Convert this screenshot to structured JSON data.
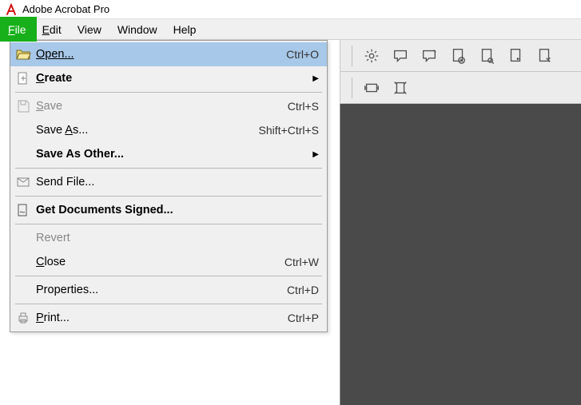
{
  "app": {
    "title": "Adobe Acrobat Pro"
  },
  "menubar": {
    "items": [
      {
        "label": "File",
        "accel": "F",
        "active": true
      },
      {
        "label": "Edit",
        "accel": "E"
      },
      {
        "label": "View",
        "accel": "V"
      },
      {
        "label": "Window",
        "accel": "W"
      },
      {
        "label": "Help",
        "accel": "H"
      }
    ]
  },
  "file_menu": {
    "open": {
      "label": "Open...",
      "shortcut": "Ctrl+O"
    },
    "create": {
      "label": "Create"
    },
    "save": {
      "label": "Save",
      "shortcut": "Ctrl+S"
    },
    "save_as": {
      "label": "Save As...",
      "accel": "A",
      "shortcut": "Shift+Ctrl+S"
    },
    "save_other": {
      "label": "Save As Other..."
    },
    "send_file": {
      "label": "Send File..."
    },
    "get_signed": {
      "label": "Get Documents Signed..."
    },
    "revert": {
      "label": "Revert"
    },
    "close": {
      "label": "Close",
      "accel": "C",
      "shortcut": "Ctrl+W"
    },
    "properties": {
      "label": "Properties...",
      "shortcut": "Ctrl+D"
    },
    "print": {
      "label": "Print...",
      "accel": "P",
      "shortcut": "Ctrl+P"
    }
  },
  "toolbar_icons": {
    "gear": "gear-icon",
    "comment": "comment-icon",
    "stamp": "stamp-icon",
    "page_x": "page-delete-icon",
    "page_search": "page-search-icon",
    "page_export": "page-export-icon",
    "page_tools": "page-tools-icon",
    "fit_width": "fit-width-icon",
    "fit_page": "fit-page-icon"
  }
}
